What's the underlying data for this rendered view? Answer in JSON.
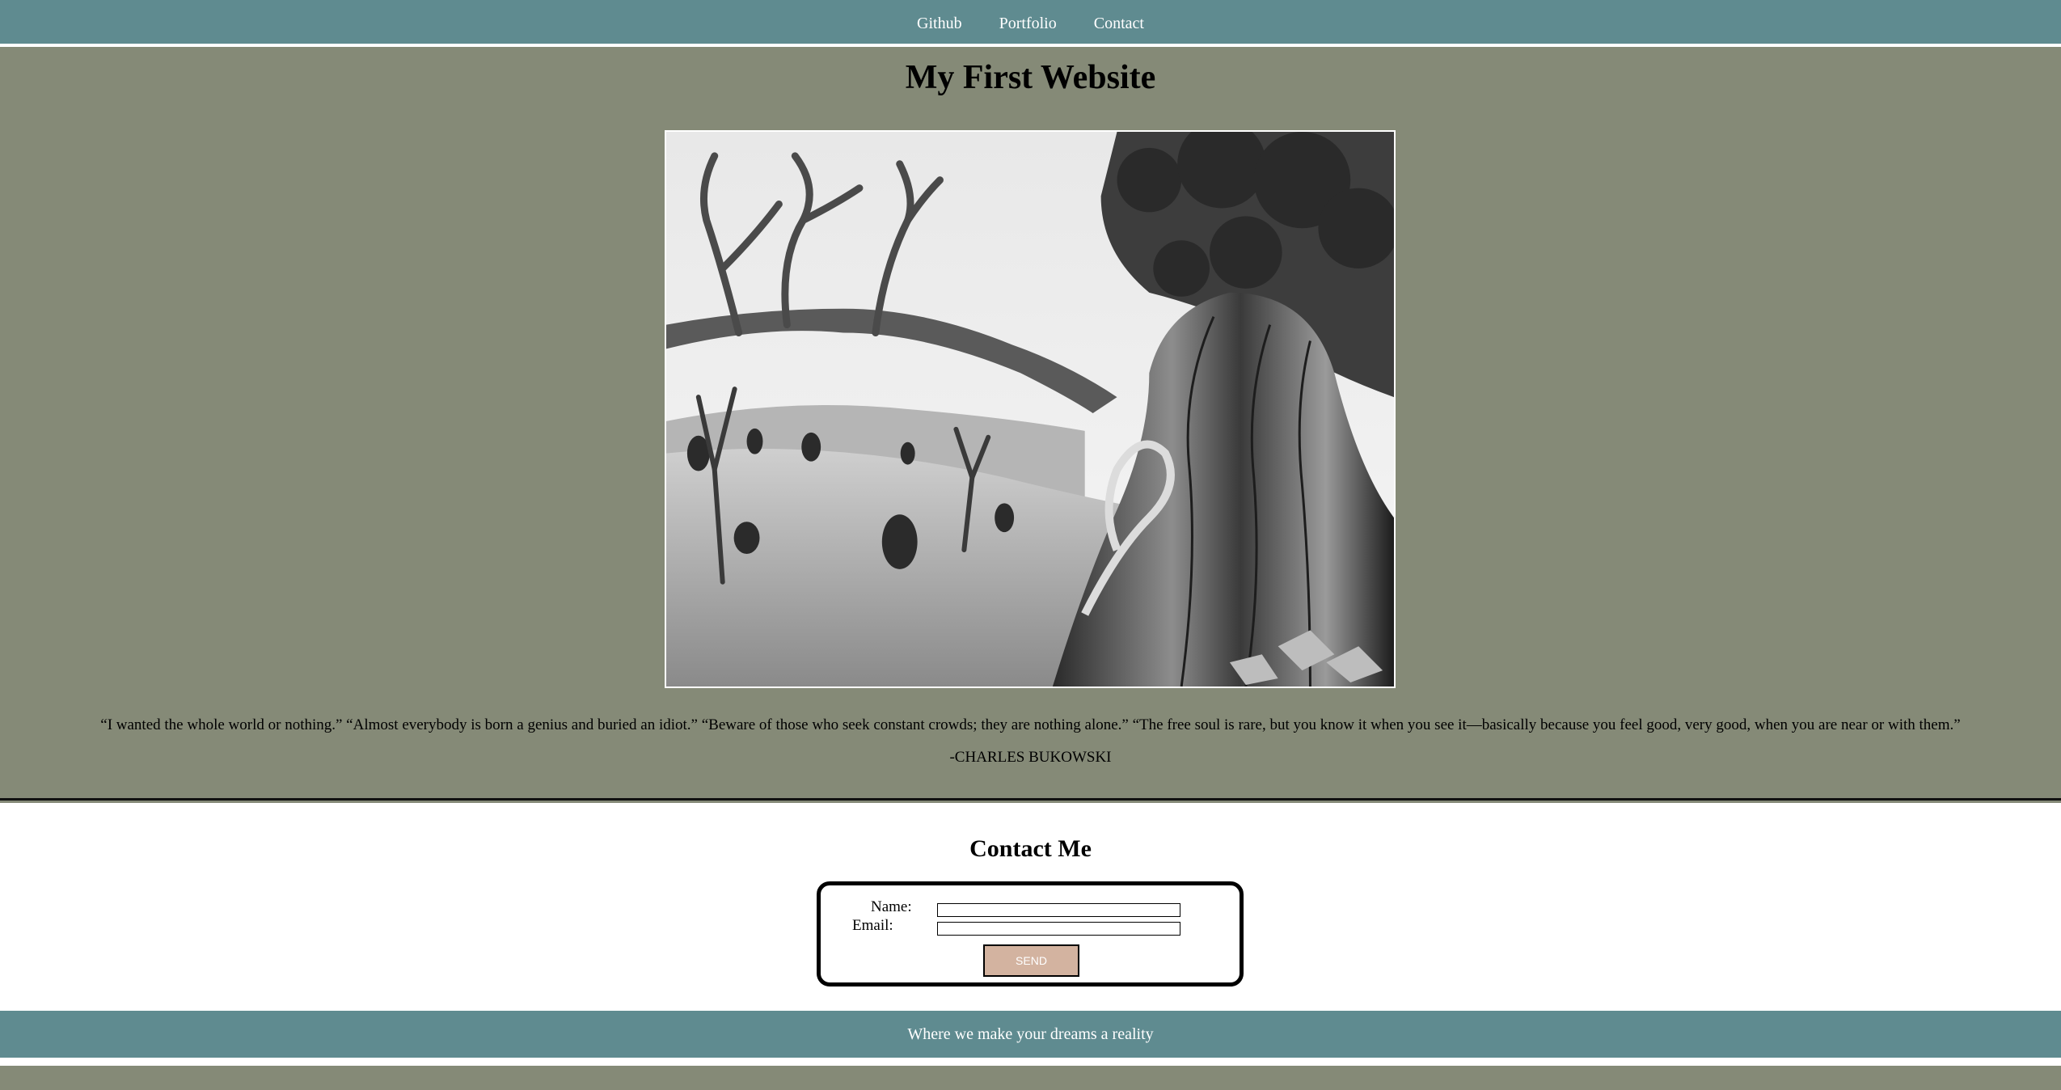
{
  "nav": {
    "links": [
      "Github",
      "Portfolio",
      "Contact"
    ]
  },
  "hero": {
    "title": "My First Website",
    "quote": "“I wanted the whole world or nothing.” “Almost everybody is born a genius and buried an idiot.” “Beware of those who seek constant crowds; they are nothing alone.” “The free soul is rare, but you know it when you see it—basically because you feel good, very good, when you are near or with them.”",
    "quote_author": "-CHARLES BUKOWSKI"
  },
  "contact": {
    "title": "Contact Me",
    "name_label": "Name:",
    "email_label": "Email:",
    "name_value": "",
    "email_value": "",
    "send_label": "SEND"
  },
  "footer": {
    "tagline": "Where we make your dreams a reality"
  },
  "colors": {
    "nav_bg": "#5f8b90",
    "hero_bg": "#858a77",
    "button_bg": "#d3b3a0",
    "text_light": "#ffffff"
  },
  "icons": {
    "hero_image": "bristlecone-pine-photo"
  }
}
